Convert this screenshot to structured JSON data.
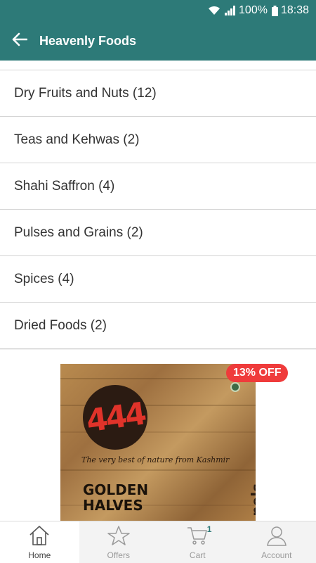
{
  "status_bar": {
    "battery": "100%",
    "time": "18:38",
    "icons": [
      "wifi-icon",
      "signal-icon",
      "battery-icon"
    ]
  },
  "app_bar": {
    "title": "Heavenly Foods",
    "back_icon": "arrow-left-icon"
  },
  "categories": [
    {
      "label": "Dry Fruits and Nuts (12)"
    },
    {
      "label": "Teas and Kehwas (2)"
    },
    {
      "label": "Shahi Saffron (4)"
    },
    {
      "label": "Pulses and Grains (2)"
    },
    {
      "label": "Spices (4)"
    },
    {
      "label": "Dried Foods (2)"
    }
  ],
  "product": {
    "discount_badge": "13% OFF",
    "logo_text": "444",
    "tagline": "The very best of nature from Kashmir",
    "name_line1": "GOLDEN",
    "name_line2": "HALVES",
    "side_text": "nels"
  },
  "bottom_nav": {
    "items": [
      {
        "label": "Home",
        "icon": "home-icon"
      },
      {
        "label": "Offers",
        "icon": "star-icon"
      },
      {
        "label": "Cart",
        "icon": "cart-icon",
        "count": "1"
      },
      {
        "label": "Account",
        "icon": "user-icon"
      }
    ]
  },
  "colors": {
    "primary": "#2d7a78",
    "badge": "#ef3b3b",
    "text": "#333333",
    "divider": "#d5d5d5"
  }
}
